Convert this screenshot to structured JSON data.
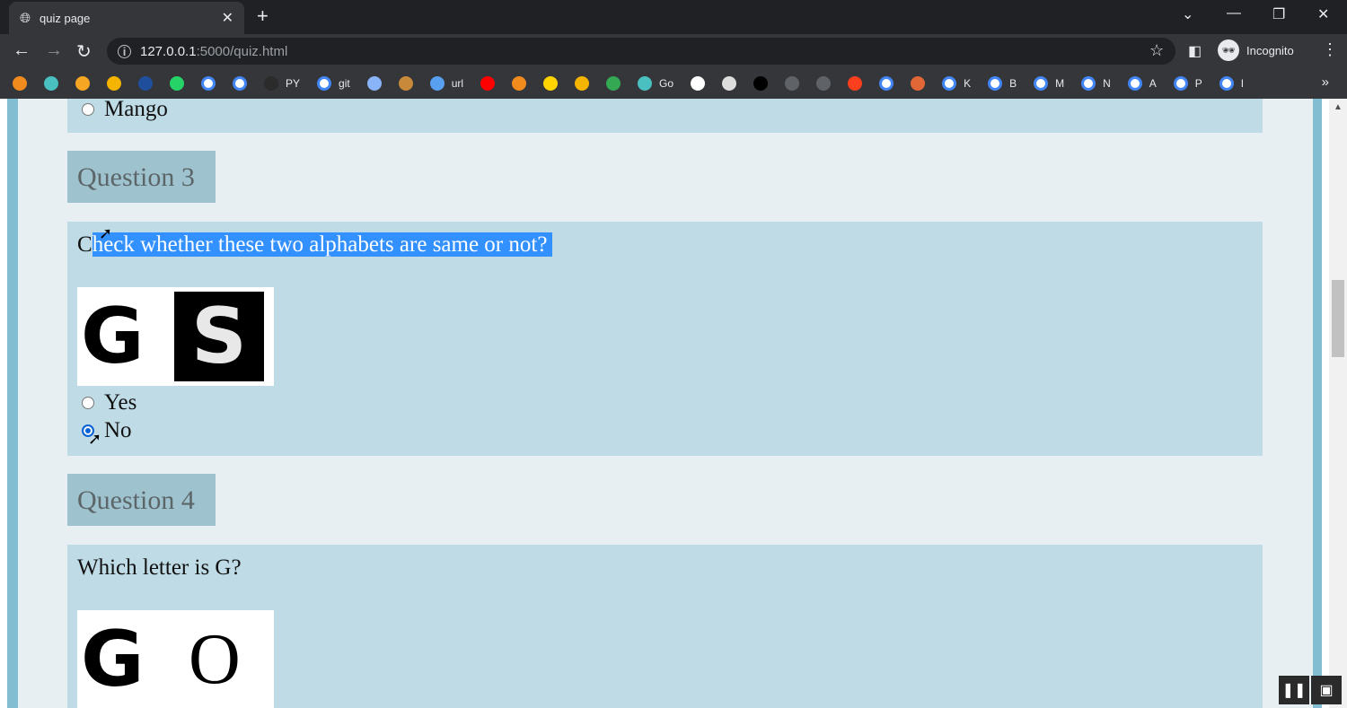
{
  "browser": {
    "tab_title": "quiz page",
    "url_host": "127.0.0.1",
    "url_path": ":5000/quiz.html",
    "profile_label": "Incognito",
    "bookmarks": [
      {
        "icon": "orange-diamond-icon",
        "color": "#f28b1e",
        "label": ""
      },
      {
        "icon": "green-leaf-icon",
        "color": "#4ac0c0",
        "label": ""
      },
      {
        "icon": "orange-doc-icon",
        "color": "#f5a623",
        "label": ""
      },
      {
        "icon": "analytics-icon",
        "color": "#f4b400",
        "label": ""
      },
      {
        "icon": "ieee-icon",
        "color": "#1f4f9c",
        "label": ""
      },
      {
        "icon": "whatsapp-icon",
        "color": "#25d366",
        "label": ""
      },
      {
        "icon": "google-icon",
        "color": "#4285f4",
        "label": ""
      },
      {
        "icon": "google-icon",
        "color": "#4285f4",
        "label": ""
      },
      {
        "icon": "github-icon",
        "color": "#2b2b2b",
        "label": "PY"
      },
      {
        "icon": "google-icon",
        "color": "#4285f4",
        "label": "git"
      },
      {
        "icon": "store-icon",
        "color": "#8ab4f8",
        "label": ""
      },
      {
        "icon": "tower-icon",
        "color": "#c88a3a",
        "label": ""
      },
      {
        "icon": "cloud-icon",
        "color": "#5aa0f0",
        "label": "url"
      },
      {
        "icon": "youtube-icon",
        "color": "#ff0000",
        "label": ""
      },
      {
        "icon": "eye-icon",
        "color": "#f28b1e",
        "label": ""
      },
      {
        "icon": "p-icon",
        "color": "#ffd400",
        "label": ""
      },
      {
        "icon": "camera-icon",
        "color": "#f5b400",
        "label": ""
      },
      {
        "icon": "ring-icon",
        "color": "#34a853",
        "label": ""
      },
      {
        "icon": "green-leaf-icon",
        "color": "#4ac0c0",
        "label": "Go"
      },
      {
        "icon": "duck-icon",
        "color": "#ffffff",
        "label": ""
      },
      {
        "icon": "doc-icon",
        "color": "#dddddd",
        "label": ""
      },
      {
        "icon": "cl-icon",
        "color": "#000000",
        "label": ""
      },
      {
        "icon": "globe-icon",
        "color": "#5f6368",
        "label": ""
      },
      {
        "icon": "globe-icon",
        "color": "#5f6368",
        "label": ""
      },
      {
        "icon": "yandex-icon",
        "color": "#fc3f1d",
        "label": ""
      },
      {
        "icon": "google-icon",
        "color": "#4285f4",
        "label": ""
      },
      {
        "icon": "matlab-icon",
        "color": "#e16737",
        "label": ""
      },
      {
        "icon": "google-icon",
        "color": "#4285f4",
        "label": "K"
      },
      {
        "icon": "google-icon",
        "color": "#4285f4",
        "label": "B"
      },
      {
        "icon": "google-icon",
        "color": "#4285f4",
        "label": "M"
      },
      {
        "icon": "google-icon",
        "color": "#4285f4",
        "label": "N"
      },
      {
        "icon": "google-icon",
        "color": "#4285f4",
        "label": "A"
      },
      {
        "icon": "google-icon",
        "color": "#4285f4",
        "label": "P"
      },
      {
        "icon": "google-icon",
        "color": "#4285f4",
        "label": "I"
      }
    ]
  },
  "quiz": {
    "prev_option": "Mango",
    "q3": {
      "heading": "Question 3",
      "text_first": "C",
      "text_selected": "heck whether these two alphabets are same or not?",
      "img_letters": [
        "G",
        "S"
      ],
      "options": [
        "Yes",
        "No"
      ],
      "selected": "No"
    },
    "q4": {
      "heading": "Question 4",
      "text": "Which letter is G?",
      "img_letters": [
        "G",
        "O"
      ]
    }
  }
}
